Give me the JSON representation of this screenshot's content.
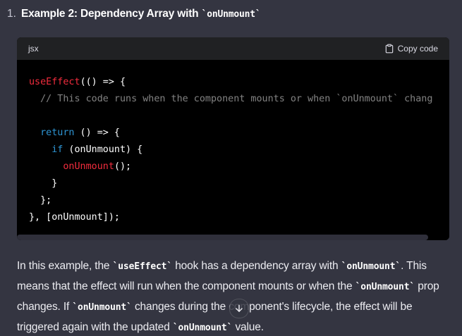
{
  "list": {
    "number": "1.",
    "heading_text": "Example 2: Dependency Array with ",
    "heading_code": "`onUnmount`"
  },
  "code_block": {
    "language": "jsx",
    "copy_label": "Copy code",
    "lines": [
      [
        {
          "t": "fn",
          "v": "useEffect"
        },
        {
          "t": "plain",
          "v": "(() => {"
        }
      ],
      [
        {
          "t": "plain",
          "v": "  "
        },
        {
          "t": "cm",
          "v": "// This code runs when the component mounts or when `onUnmount` chang"
        }
      ],
      [
        {
          "t": "plain",
          "v": ""
        }
      ],
      [
        {
          "t": "plain",
          "v": "  "
        },
        {
          "t": "kw",
          "v": "return"
        },
        {
          "t": "plain",
          "v": " () => {"
        }
      ],
      [
        {
          "t": "plain",
          "v": "    "
        },
        {
          "t": "kw",
          "v": "if"
        },
        {
          "t": "plain",
          "v": " (onUnmount) {"
        }
      ],
      [
        {
          "t": "plain",
          "v": "      "
        },
        {
          "t": "fn",
          "v": "onUnmount"
        },
        {
          "t": "plain",
          "v": "();"
        }
      ],
      [
        {
          "t": "plain",
          "v": "    }"
        }
      ],
      [
        {
          "t": "plain",
          "v": "  };"
        }
      ],
      [
        {
          "t": "plain",
          "v": "}, [onUnmount]);"
        }
      ]
    ]
  },
  "paragraph": [
    {
      "t": "text",
      "v": "In this example, the "
    },
    {
      "t": "code",
      "v": "`useEffect`"
    },
    {
      "t": "text",
      "v": " hook has a dependency array with "
    },
    {
      "t": "code",
      "v": "`onUnmount`"
    },
    {
      "t": "text",
      "v": ". This means that the effect will run when the component mounts or when the "
    },
    {
      "t": "code",
      "v": "`onUnmount`"
    },
    {
      "t": "text",
      "v": " prop changes. If "
    },
    {
      "t": "code",
      "v": "`onUnmount`"
    },
    {
      "t": "text",
      "v": " changes during the component's lifecycle, the effect will be triggered again with the updated "
    },
    {
      "t": "code",
      "v": "`onUnmount`"
    },
    {
      "t": "text",
      "v": " value."
    }
  ],
  "icons": {
    "copy": "clipboard-icon",
    "scroll_down": "arrow-down-icon"
  },
  "colors": {
    "background": "#343541",
    "code_background": "#000000",
    "code_header": "#202123",
    "token_function": "#f22c3d",
    "token_keyword": "#2e95d3",
    "token_comment": "rgba(255,255,255,0.5)"
  }
}
